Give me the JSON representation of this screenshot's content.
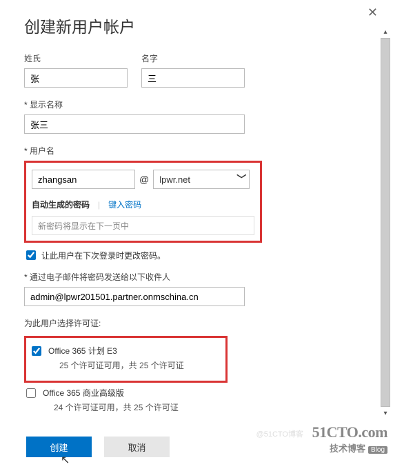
{
  "dialog": {
    "title": "创建新用户帐户",
    "close": "✕"
  },
  "fields": {
    "lastname": {
      "label": "姓氏",
      "value": "张"
    },
    "firstname": {
      "label": "名字",
      "value": "三"
    },
    "displayname": {
      "label": "显示名称",
      "value": "张三"
    },
    "username": {
      "label": "用户名",
      "value": "zhangsan",
      "domain": "lpwr.net",
      "at": "@"
    },
    "password": {
      "auto_label": "自动生成的密码",
      "separator": "|",
      "manual_link": "键入密码",
      "note": "新密码将显示在下一页中"
    },
    "force_change": {
      "label": "让此用户在下次登录时更改密码。",
      "checked": true
    },
    "email_recipient": {
      "label": "通过电子邮件将密码发送给以下收件人",
      "value": "admin@lpwr201501.partner.onmschina.cn"
    }
  },
  "licenses": {
    "label": "为此用户选择许可证:",
    "items": [
      {
        "title": "Office 365 计划 E3",
        "sub": "25 个许可证可用，共 25 个许可证",
        "checked": true
      },
      {
        "title": "Office 365 商业高级版",
        "sub": "24 个许可证可用，共 25 个许可证",
        "checked": false
      }
    ]
  },
  "buttons": {
    "create": "创建",
    "cancel": "取消"
  },
  "watermark": {
    "top": "51CTO.com",
    "bottom": "技术博客",
    "blog": "Blog",
    "attribution": "@51CTO博客"
  }
}
